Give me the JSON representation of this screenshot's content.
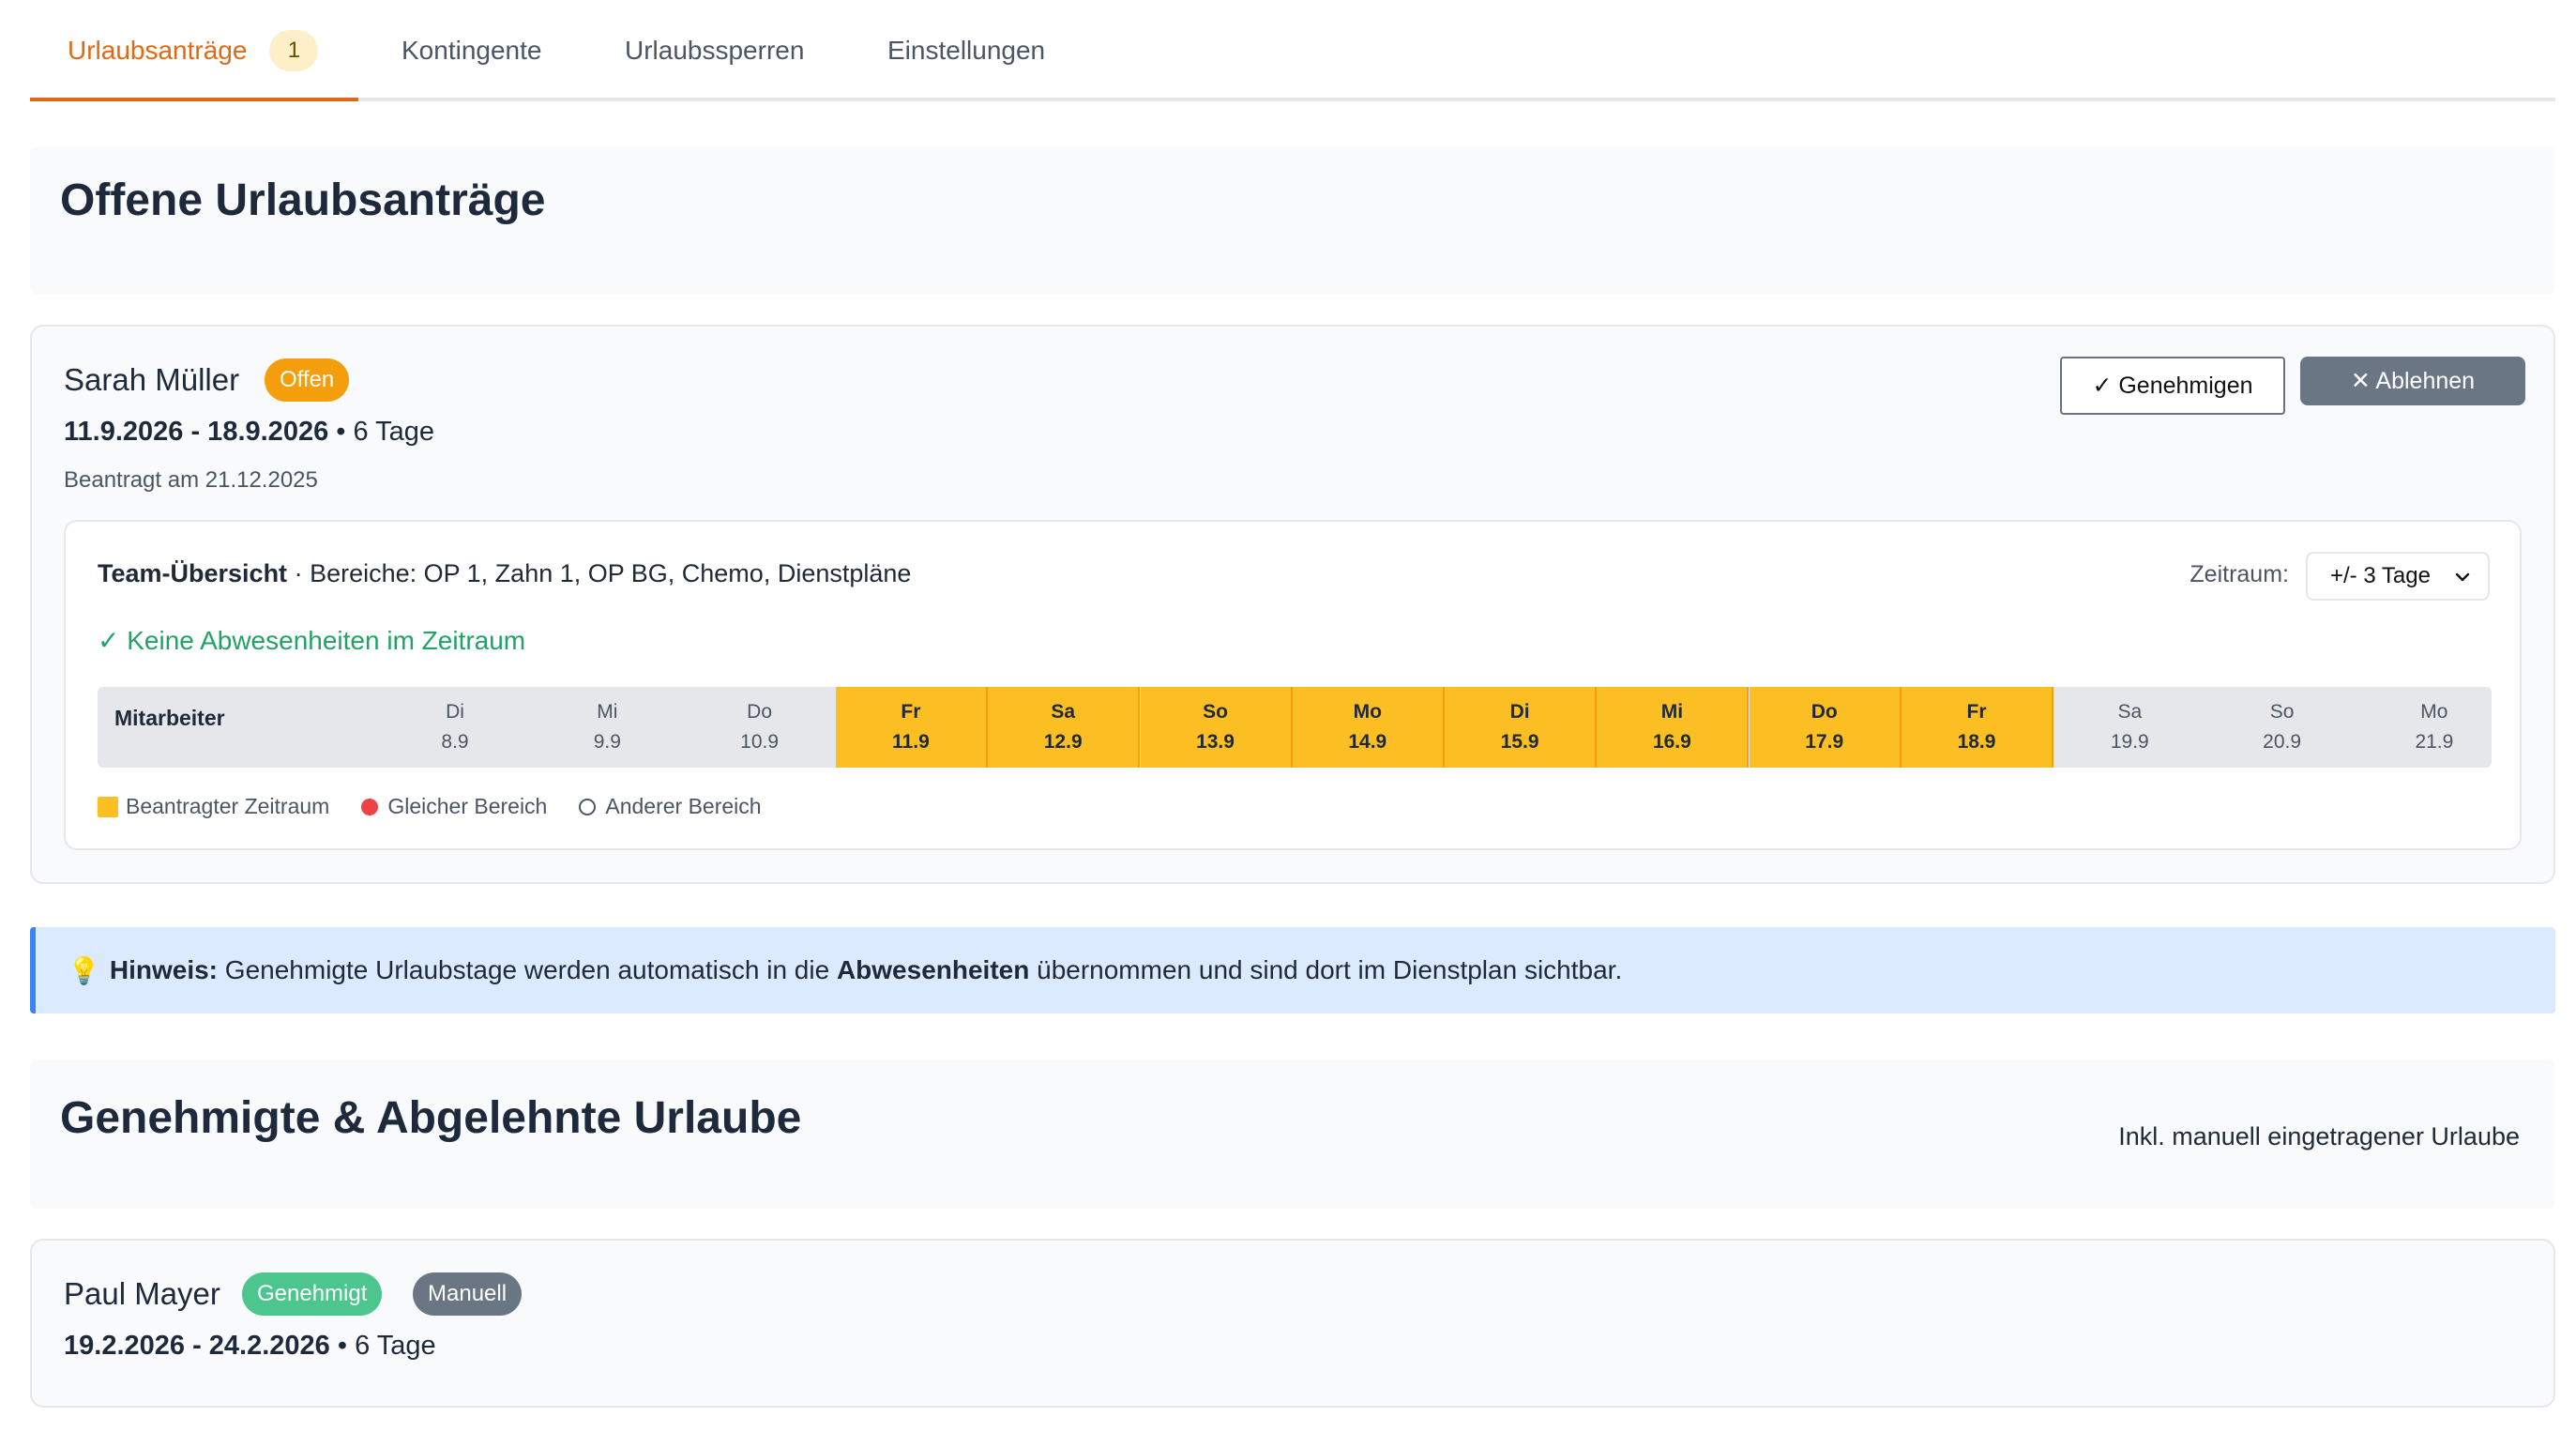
{
  "tabs": [
    {
      "label": "Urlaubsanträge",
      "badge": "1"
    },
    {
      "label": "Kontingente"
    },
    {
      "label": "Urlaubssperren"
    },
    {
      "label": "Einstellungen"
    }
  ],
  "open_section": {
    "title": "Offene Urlaubsanträge"
  },
  "request": {
    "name": "Sarah Müller",
    "status": "Offen",
    "date_range": "11.9.2026 - 18.9.2026",
    "sep": "•",
    "days": "6 Tage",
    "requested": "Beantragt am 21.12.2025",
    "approve_label": "✓ Genehmigen",
    "reject_label": "✕ Ablehnen",
    "team": {
      "title": "Team-Übersicht",
      "areas": "· Bereiche: OP 1, Zahn 1, OP BG, Chemo, Dienstpläne",
      "no_absence": "✓ Keine Abwesenheiten im Zeitraum",
      "range_label": "Zeitraum:",
      "range_value": "+/- 3 Tage",
      "employee_col": "Mitarbeiter",
      "days": [
        {
          "wd": "Di",
          "date": "8.9",
          "selected": false
        },
        {
          "wd": "Mi",
          "date": "9.9",
          "selected": false
        },
        {
          "wd": "Do",
          "date": "10.9",
          "selected": false
        },
        {
          "wd": "Fr",
          "date": "11.9",
          "selected": true
        },
        {
          "wd": "Sa",
          "date": "12.9",
          "selected": true
        },
        {
          "wd": "So",
          "date": "13.9",
          "selected": true
        },
        {
          "wd": "Mo",
          "date": "14.9",
          "selected": true
        },
        {
          "wd": "Di",
          "date": "15.9",
          "selected": true
        },
        {
          "wd": "Mi",
          "date": "16.9",
          "selected": true
        },
        {
          "wd": "Do",
          "date": "17.9",
          "selected": true
        },
        {
          "wd": "Fr",
          "date": "18.9",
          "selected": true
        },
        {
          "wd": "Sa",
          "date": "19.9",
          "selected": false
        },
        {
          "wd": "So",
          "date": "20.9",
          "selected": false
        },
        {
          "wd": "Mo",
          "date": "21.9",
          "selected": false
        }
      ],
      "legend": {
        "requested": "Beantragter Zeitraum",
        "same_area": "Gleicher Bereich",
        "other_area": "Anderer Bereich"
      }
    }
  },
  "hint": {
    "icon": "💡",
    "label": "Hinweis:",
    "text_before": " Genehmigte Urlaubstage werden automatisch in die ",
    "bold": "Abwesenheiten",
    "text_after": " übernommen und sind dort im Dienstplan sichtbar."
  },
  "done_section": {
    "title": "Genehmigte & Abgelehnte Urlaube",
    "note": "Inkl. manuell eingetragener Urlaube"
  },
  "done_item": {
    "name": "Paul Mayer",
    "status": "Genehmigt",
    "tag": "Manuell",
    "date_range": "19.2.2026 - 24.2.2026",
    "sep": "•",
    "days": "6 Tage"
  },
  "colors": {
    "accent": "#e06a14",
    "open_badge": "#f59e0b",
    "approved_badge": "#4cc58f",
    "manual_badge": "#6b7684",
    "selected_day": "#fbbf24",
    "same_area_dot": "#ef4444",
    "success_text": "#21a366"
  }
}
